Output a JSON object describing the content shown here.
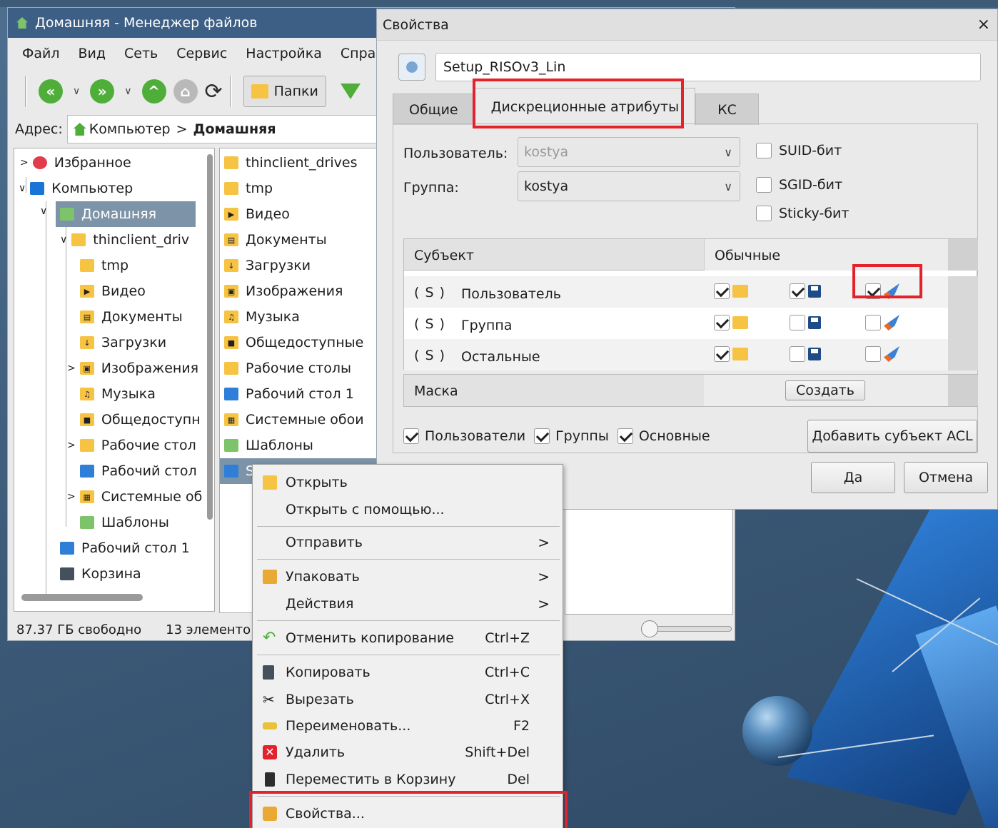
{
  "fm": {
    "title": "Домашняя - Менеджер файлов",
    "menu": [
      "Файл",
      "Вид",
      "Сеть",
      "Сервис",
      "Настройка",
      "Спра"
    ],
    "folders_button": "Папки",
    "address_label": "Адрес:",
    "address": {
      "part1": "Компьютер",
      "sep": ">",
      "part2": "Домашняя"
    },
    "tree": [
      {
        "label": "Избранное"
      },
      {
        "label": "Компьютер"
      },
      {
        "label": "Домашняя"
      },
      {
        "label": "thinclient_driv"
      },
      {
        "label": "tmp"
      },
      {
        "label": "Видео"
      },
      {
        "label": "Документы"
      },
      {
        "label": "Загрузки"
      },
      {
        "label": "Изображения"
      },
      {
        "label": "Музыка"
      },
      {
        "label": "Общедоступн"
      },
      {
        "label": "Рабочие стол"
      },
      {
        "label": "Рабочий стол"
      },
      {
        "label": "Системные об"
      },
      {
        "label": "Шаблоны"
      },
      {
        "label": "Рабочий стол 1"
      },
      {
        "label": "Корзина"
      }
    ],
    "files": [
      {
        "label": "thinclient_drives"
      },
      {
        "label": "tmp"
      },
      {
        "label": "Видео"
      },
      {
        "label": "Документы"
      },
      {
        "label": "Загрузки"
      },
      {
        "label": "Изображения"
      },
      {
        "label": "Музыка"
      },
      {
        "label": "Общедоступные"
      },
      {
        "label": "Рабочие столы"
      },
      {
        "label": "Рабочий стол 1"
      },
      {
        "label": "Системные обои"
      },
      {
        "label": "Шаблоны"
      },
      {
        "label": "S"
      }
    ],
    "status_free": "87.37 ГБ свободно",
    "status_count": "13 элементо"
  },
  "dialog": {
    "title": "Свойства",
    "close": "×",
    "filename": "Setup_RISOv3_Lin",
    "tabs": [
      "Общие",
      "Дискреционные атрибуты",
      "КС"
    ],
    "user_label": "Пользователь:",
    "user_value": "kostya",
    "group_label": "Группа:",
    "group_value": "kostya",
    "suid": "SUID-бит",
    "sgid": "SGID-бит",
    "sticky": "Sticky-бит",
    "col_subject": "Субъект",
    "col_regular": "Обычные",
    "rows": [
      {
        "tag": "( S )",
        "name": "Пользователь",
        "r": true,
        "w": true,
        "x": true
      },
      {
        "tag": "( S )",
        "name": "Группа",
        "r": true,
        "w": false,
        "x": false
      },
      {
        "tag": "( S )",
        "name": "Остальные",
        "r": true,
        "w": false,
        "x": false
      }
    ],
    "mask_label": "Маска",
    "create_button": "Создать",
    "filter_users": "Пользователи",
    "filter_groups": "Группы",
    "filter_main": "Основные",
    "add_acl_button": "Добавить субъект ACL",
    "ok_button": "Да",
    "cancel_button": "Отмена"
  },
  "context_menu": {
    "open": "Открыть",
    "open_with": "Открыть с помощью...",
    "send": "Отправить",
    "pack": "Упаковать",
    "actions": "Действия",
    "undo_copy": "Отменить копирование",
    "undo_copy_sc": "Ctrl+Z",
    "copy": "Копировать",
    "copy_sc": "Ctrl+C",
    "cut": "Вырезать",
    "cut_sc": "Ctrl+X",
    "rename": "Переименовать...",
    "rename_sc": "F2",
    "delete": "Удалить",
    "delete_sc": "Shift+Del",
    "trash": "Переместить в Корзину",
    "trash_sc": "Del",
    "properties": "Свойства...",
    "submenu_arrow": ">"
  },
  "colors": {
    "highlight": "#e3222b",
    "selection": "#7d93a8",
    "titlebar": "#3d5f86"
  }
}
